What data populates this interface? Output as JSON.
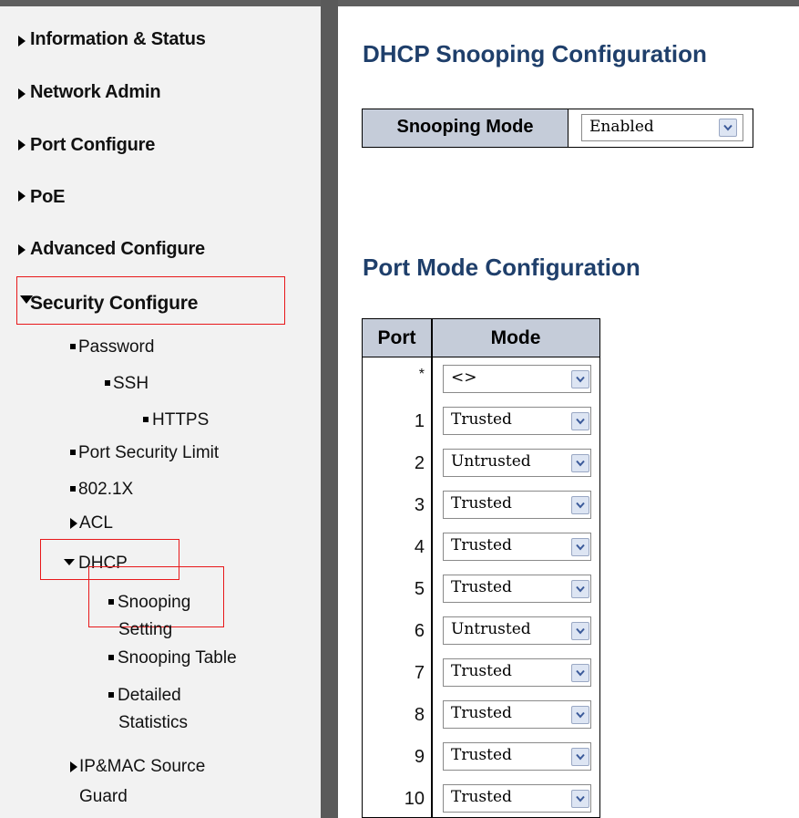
{
  "sidebar": {
    "items": [
      {
        "label": "Information & Status"
      },
      {
        "label": "Network Admin"
      },
      {
        "label": "Port Configure"
      },
      {
        "label": "PoE"
      },
      {
        "label": "Advanced Configure"
      },
      {
        "label": "Security Configure",
        "expanded": true,
        "highlighted": true
      }
    ],
    "security": {
      "password": "Password",
      "ssh": "SSH",
      "https": "HTTPS",
      "port_security_limit": "Port Security Limit",
      "dot1x": "802.1X",
      "acl": "ACL",
      "dhcp": "DHCP",
      "dhcp_children": {
        "snooping_setting_line1": "Snooping",
        "snooping_setting_line2": "Setting",
        "snooping_table": "Snooping Table",
        "detailed_statistics_line1": "Detailed",
        "detailed_statistics_line2": "Statistics"
      },
      "ip_mac_source_guard_line1": "IP&MAC Source",
      "ip_mac_source_guard_line2": "Guard"
    },
    "highlight_color": "#e8181a"
  },
  "main": {
    "title": "DHCP Snooping Configuration",
    "snooping_mode": {
      "label": "Snooping Mode",
      "value": "Enabled"
    },
    "port_mode_title": "Port Mode Configuration",
    "port_table": {
      "headers": {
        "port": "Port",
        "mode": "Mode"
      },
      "rows": [
        {
          "port": "*",
          "mode": "<>"
        },
        {
          "port": "1",
          "mode": "Trusted"
        },
        {
          "port": "2",
          "mode": "Untrusted"
        },
        {
          "port": "3",
          "mode": "Trusted"
        },
        {
          "port": "4",
          "mode": "Trusted"
        },
        {
          "port": "5",
          "mode": "Trusted"
        },
        {
          "port": "6",
          "mode": "Untrusted"
        },
        {
          "port": "7",
          "mode": "Trusted"
        },
        {
          "port": "8",
          "mode": "Trusted"
        },
        {
          "port": "9",
          "mode": "Trusted"
        },
        {
          "port": "10",
          "mode": "Trusted"
        }
      ]
    },
    "heading_color": "#1f3f6b",
    "header_bg": "#c5ccd9"
  }
}
